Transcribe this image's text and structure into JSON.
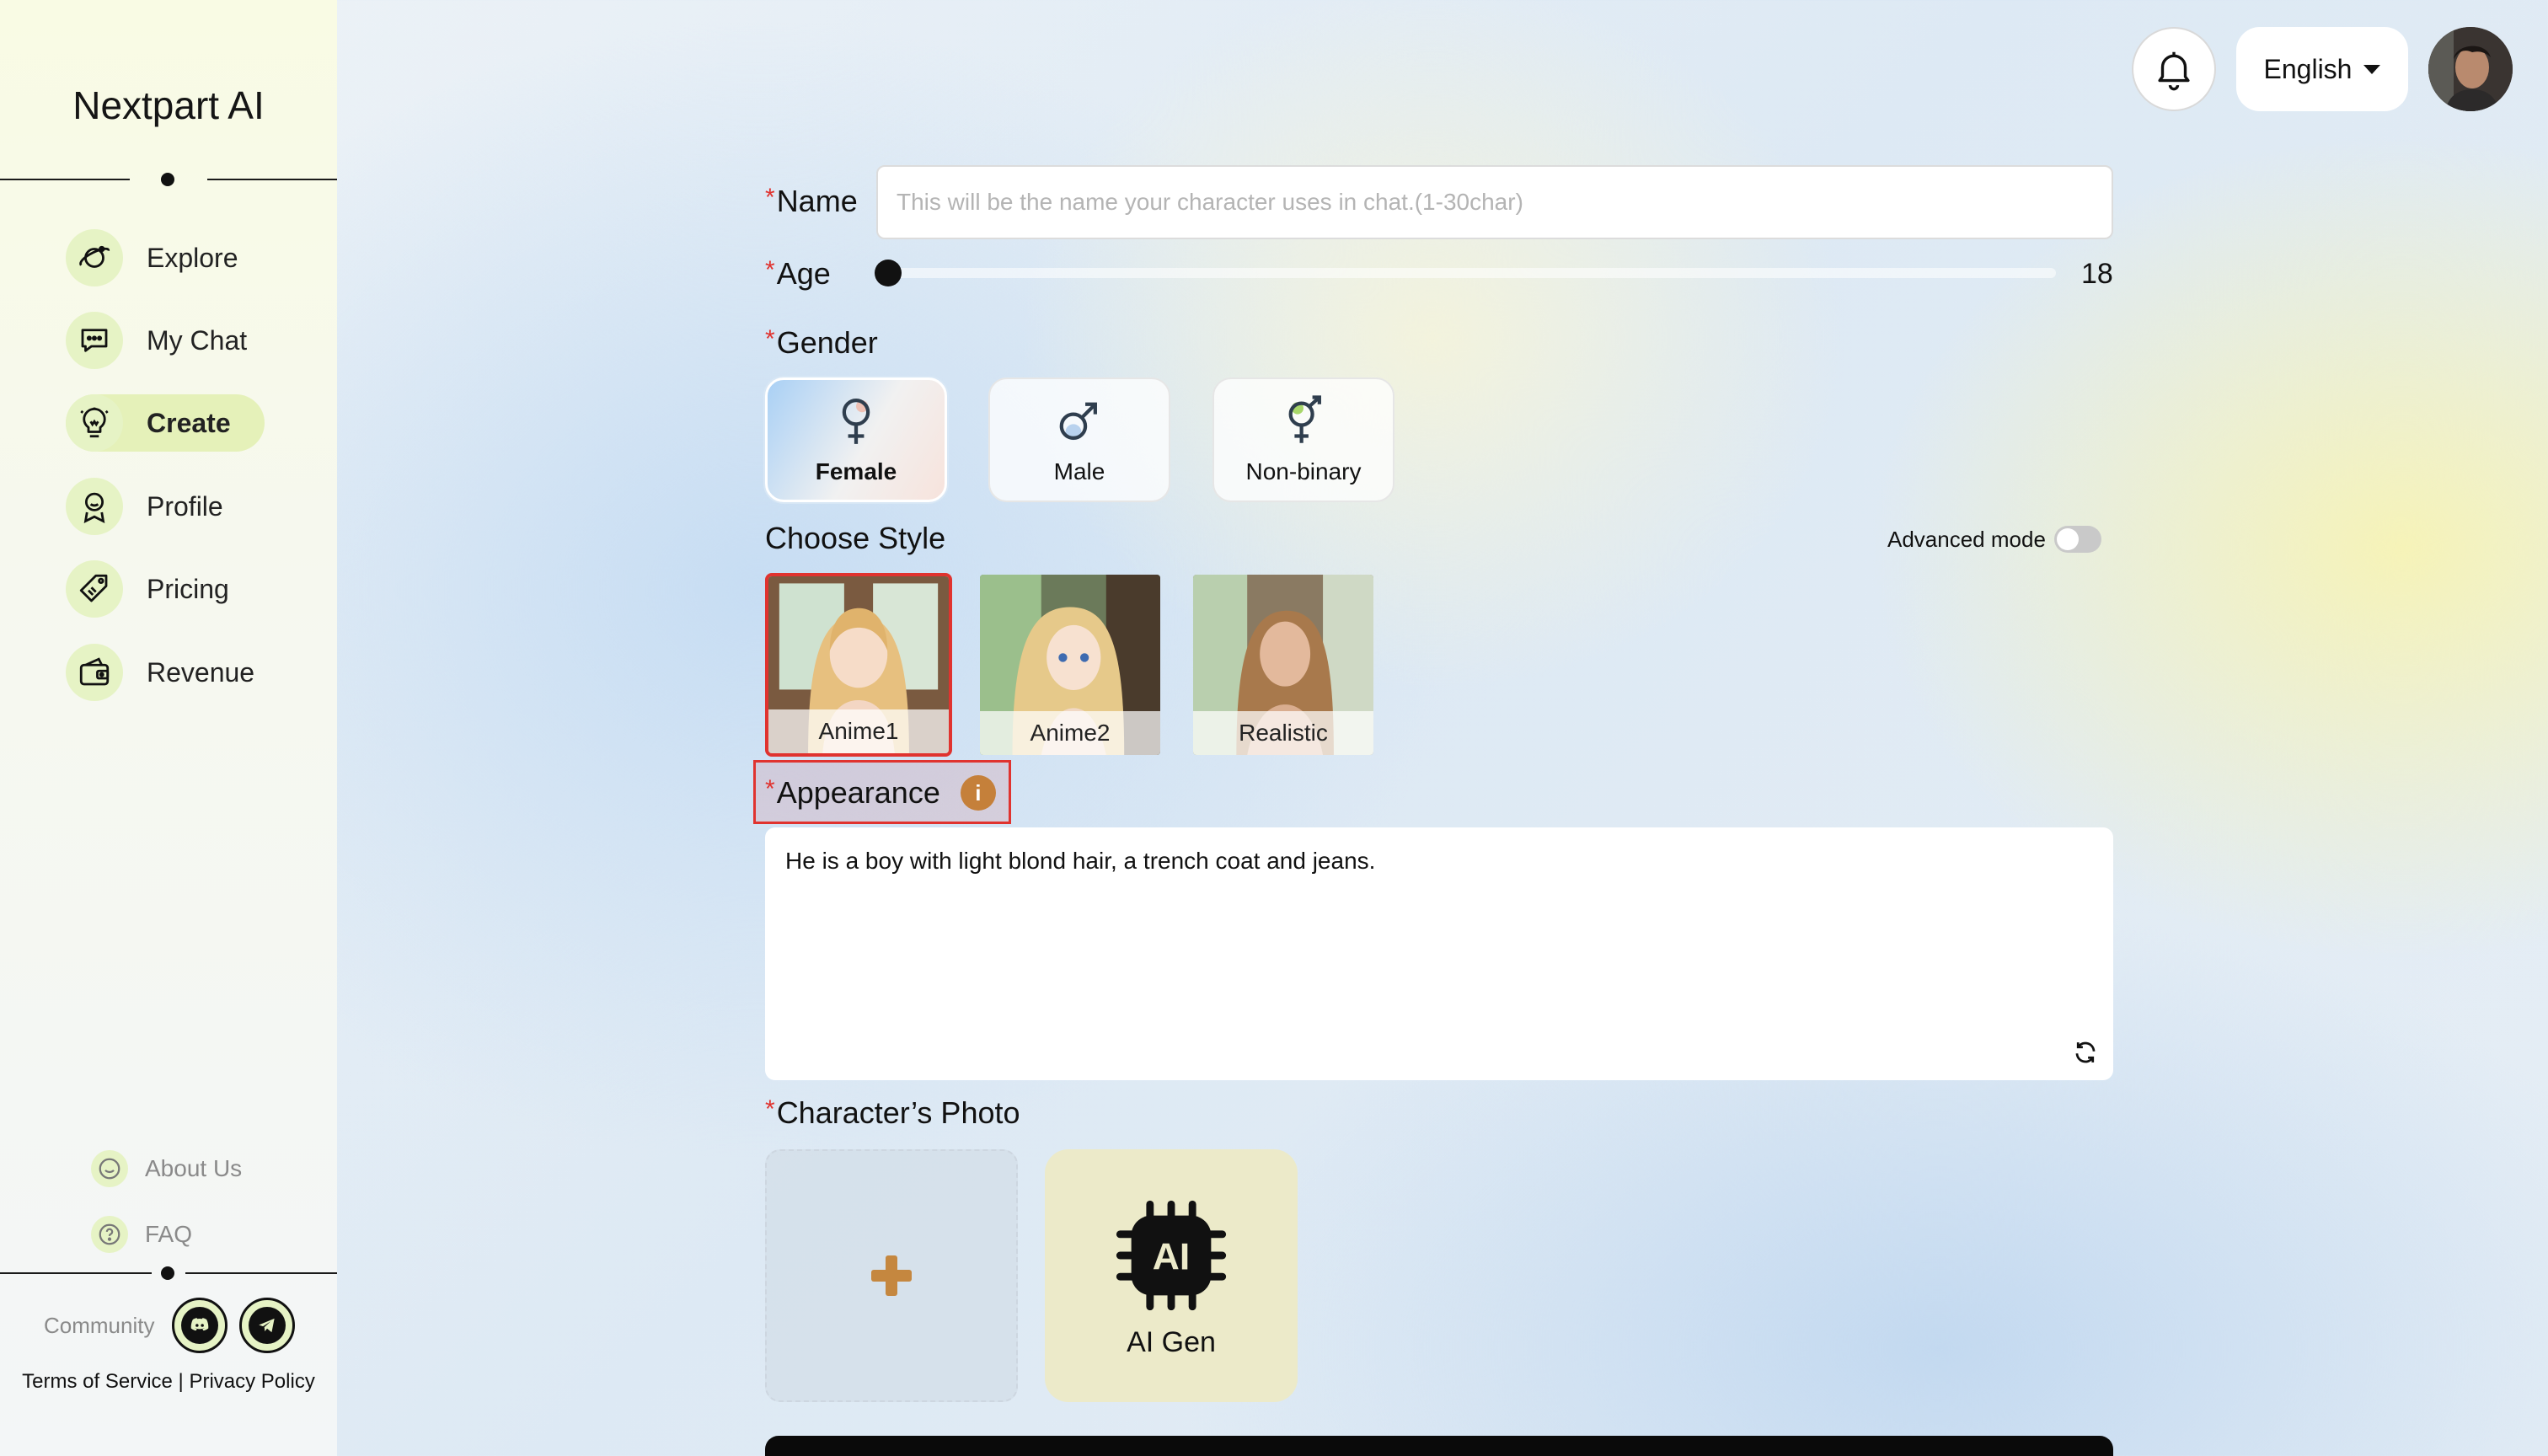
{
  "app": {
    "brand": "Nextpart AI"
  },
  "sidebar": {
    "items": [
      {
        "label": "Explore",
        "icon": "planet-icon"
      },
      {
        "label": "My Chat",
        "icon": "chat-icon"
      },
      {
        "label": "Create",
        "icon": "lightbulb-icon",
        "active": true
      },
      {
        "label": "Profile",
        "icon": "profile-icon"
      },
      {
        "label": "Pricing",
        "icon": "tag-icon"
      },
      {
        "label": "Revenue",
        "icon": "wallet-icon"
      }
    ],
    "links": {
      "about": "About Us",
      "faq": "FAQ"
    },
    "community": "Community",
    "legal": {
      "terms": "Terms of Service",
      "separator": "|",
      "privacy": "Privacy Policy"
    }
  },
  "header": {
    "language": "English"
  },
  "form": {
    "required_mark": "*",
    "name": {
      "label": "Name",
      "value": "",
      "placeholder": "This will be the name your character uses in chat.(1-30char)"
    },
    "age": {
      "label": "Age",
      "value": "18"
    },
    "gender": {
      "label": "Gender",
      "options": [
        {
          "label": "Female",
          "selected": true
        },
        {
          "label": "Male",
          "selected": false
        },
        {
          "label": "Non-binary",
          "selected": false
        }
      ]
    },
    "style": {
      "label": "Choose Style",
      "advanced_mode_label": "Advanced mode",
      "advanced_mode_on": false,
      "options": [
        {
          "label": "Anime1",
          "selected": true
        },
        {
          "label": "Anime2",
          "selected": false
        },
        {
          "label": "Realistic",
          "selected": false
        }
      ]
    },
    "appearance": {
      "label": "Appearance",
      "info_icon": "i",
      "value": "He is a boy with light blond hair, a trench coat and jeans."
    },
    "photo": {
      "label": "Character’s Photo",
      "ai_gen_label": "AI Gen",
      "ai_chip_text": "AI"
    }
  },
  "colors": {
    "required": "#e0332f",
    "accent_green": "#e5f1b9",
    "info": "#c5803a",
    "selection_border": "#e0332f"
  }
}
